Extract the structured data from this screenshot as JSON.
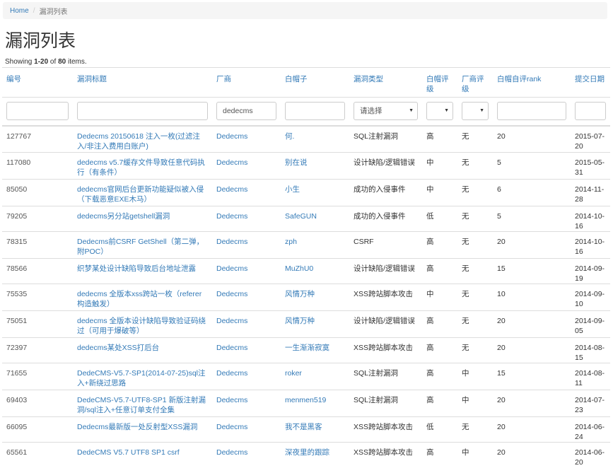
{
  "breadcrumb": {
    "home": "Home",
    "separator": "/",
    "current": "漏洞列表"
  },
  "page_title": "漏洞列表",
  "summary": {
    "prefix": "Showing ",
    "range": "1-20",
    "of": " of ",
    "total": "80",
    "suffix": " items."
  },
  "table": {
    "columns": [
      "编号",
      "漏洞标题",
      "厂商",
      "白帽子",
      "漏洞类型",
      "白帽评级",
      "厂商评级",
      "白帽自评rank",
      "提交日期"
    ],
    "filters": {
      "id": "",
      "title": "",
      "vendor": "dedecms",
      "whitehat": "",
      "type": "请选择",
      "whitehat_rating": "",
      "vendor_rating": "",
      "rank": "",
      "date": ""
    },
    "rows": [
      {
        "id": "127767",
        "title": "Dedecms 20150618 注入一枚(过滤注入/非注入费用白账户)",
        "vendor": "Dedecms",
        "whitehat": "何.",
        "type": "SQL注射漏洞",
        "wh_rating": "高",
        "v_rating": "无",
        "rank": "20",
        "date": "2015-07-20"
      },
      {
        "id": "117080",
        "title": "dedecms v5.7缓存文件导致任意代码执行（有条件）",
        "vendor": "Dedecms",
        "whitehat": "别在说",
        "type": "设计缺陷/逻辑错误",
        "wh_rating": "中",
        "v_rating": "无",
        "rank": "5",
        "date": "2015-05-31"
      },
      {
        "id": "85050",
        "title": "dedecms官网后台更新功能疑似被入侵（下载恶意EXE木马）",
        "vendor": "Dedecms",
        "whitehat": "小生",
        "type": "成功的入侵事件",
        "wh_rating": "中",
        "v_rating": "无",
        "rank": "6",
        "date": "2014-11-28"
      },
      {
        "id": "79205",
        "title": "dedecms另分站getshell漏洞",
        "vendor": "Dedecms",
        "whitehat": "SafeGUN",
        "type": "成功的入侵事件",
        "wh_rating": "低",
        "v_rating": "无",
        "rank": "5",
        "date": "2014-10-16"
      },
      {
        "id": "78315",
        "title": "Dedecms前CSRF GetShell（第二弹，附POC）",
        "vendor": "Dedecms",
        "whitehat": "zph",
        "type": "CSRF",
        "wh_rating": "高",
        "v_rating": "无",
        "rank": "20",
        "date": "2014-10-16"
      },
      {
        "id": "78566",
        "title": "织梦某处设计缺陷导致后台地址泄露",
        "vendor": "Dedecms",
        "whitehat": "MuZhU0",
        "type": "设计缺陷/逻辑错误",
        "wh_rating": "高",
        "v_rating": "无",
        "rank": "15",
        "date": "2014-09-19"
      },
      {
        "id": "75535",
        "title": "dedecms 全版本xss跨站一枚（referer构造触发）",
        "vendor": "Dedecms",
        "whitehat": "风情万种",
        "type": "XSS跨站脚本攻击",
        "wh_rating": "中",
        "v_rating": "无",
        "rank": "10",
        "date": "2014-09-10"
      },
      {
        "id": "75051",
        "title": "dedecms 全版本设计缺陷导致验证码绕过（可用于爆破等）",
        "vendor": "Dedecms",
        "whitehat": "风情万种",
        "type": "设计缺陷/逻辑错误",
        "wh_rating": "高",
        "v_rating": "无",
        "rank": "20",
        "date": "2014-09-05"
      },
      {
        "id": "72397",
        "title": "dedecms某处XSS打后台",
        "vendor": "Dedecms",
        "whitehat": "一生渐渐寂寞",
        "type": "XSS跨站脚本攻击",
        "wh_rating": "高",
        "v_rating": "无",
        "rank": "20",
        "date": "2014-08-15"
      },
      {
        "id": "71655",
        "title": "DedeCMS-V5.7-SP1(2014-07-25)sql注入+新绕过思路",
        "vendor": "Dedecms",
        "whitehat": "roker",
        "type": "SQL注射漏洞",
        "wh_rating": "高",
        "v_rating": "中",
        "rank": "15",
        "date": "2014-08-11"
      },
      {
        "id": "69403",
        "title": "DedeCMS-V5.7-UTF8-SP1 新版注射漏洞/sql注入+任意订单支付全集",
        "vendor": "Dedecms",
        "whitehat": "menmen519",
        "type": "SQL注射漏洞",
        "wh_rating": "高",
        "v_rating": "中",
        "rank": "20",
        "date": "2014-07-23"
      },
      {
        "id": "66095",
        "title": "Dedecms最新版一处反射型XSS漏洞",
        "vendor": "Dedecms",
        "whitehat": "我不是黑客",
        "type": "XSS跨站脚本攻击",
        "wh_rating": "低",
        "v_rating": "无",
        "rank": "20",
        "date": "2014-06-24"
      },
      {
        "id": "65561",
        "title": "DedeCMS V5.7 UTF8 SP1 csrf",
        "vendor": "Dedecms",
        "whitehat": "深夜里的跟踪",
        "type": "XSS跨站脚本攻击",
        "wh_rating": "高",
        "v_rating": "中",
        "rank": "20",
        "date": "2014-06-20"
      }
    ]
  }
}
